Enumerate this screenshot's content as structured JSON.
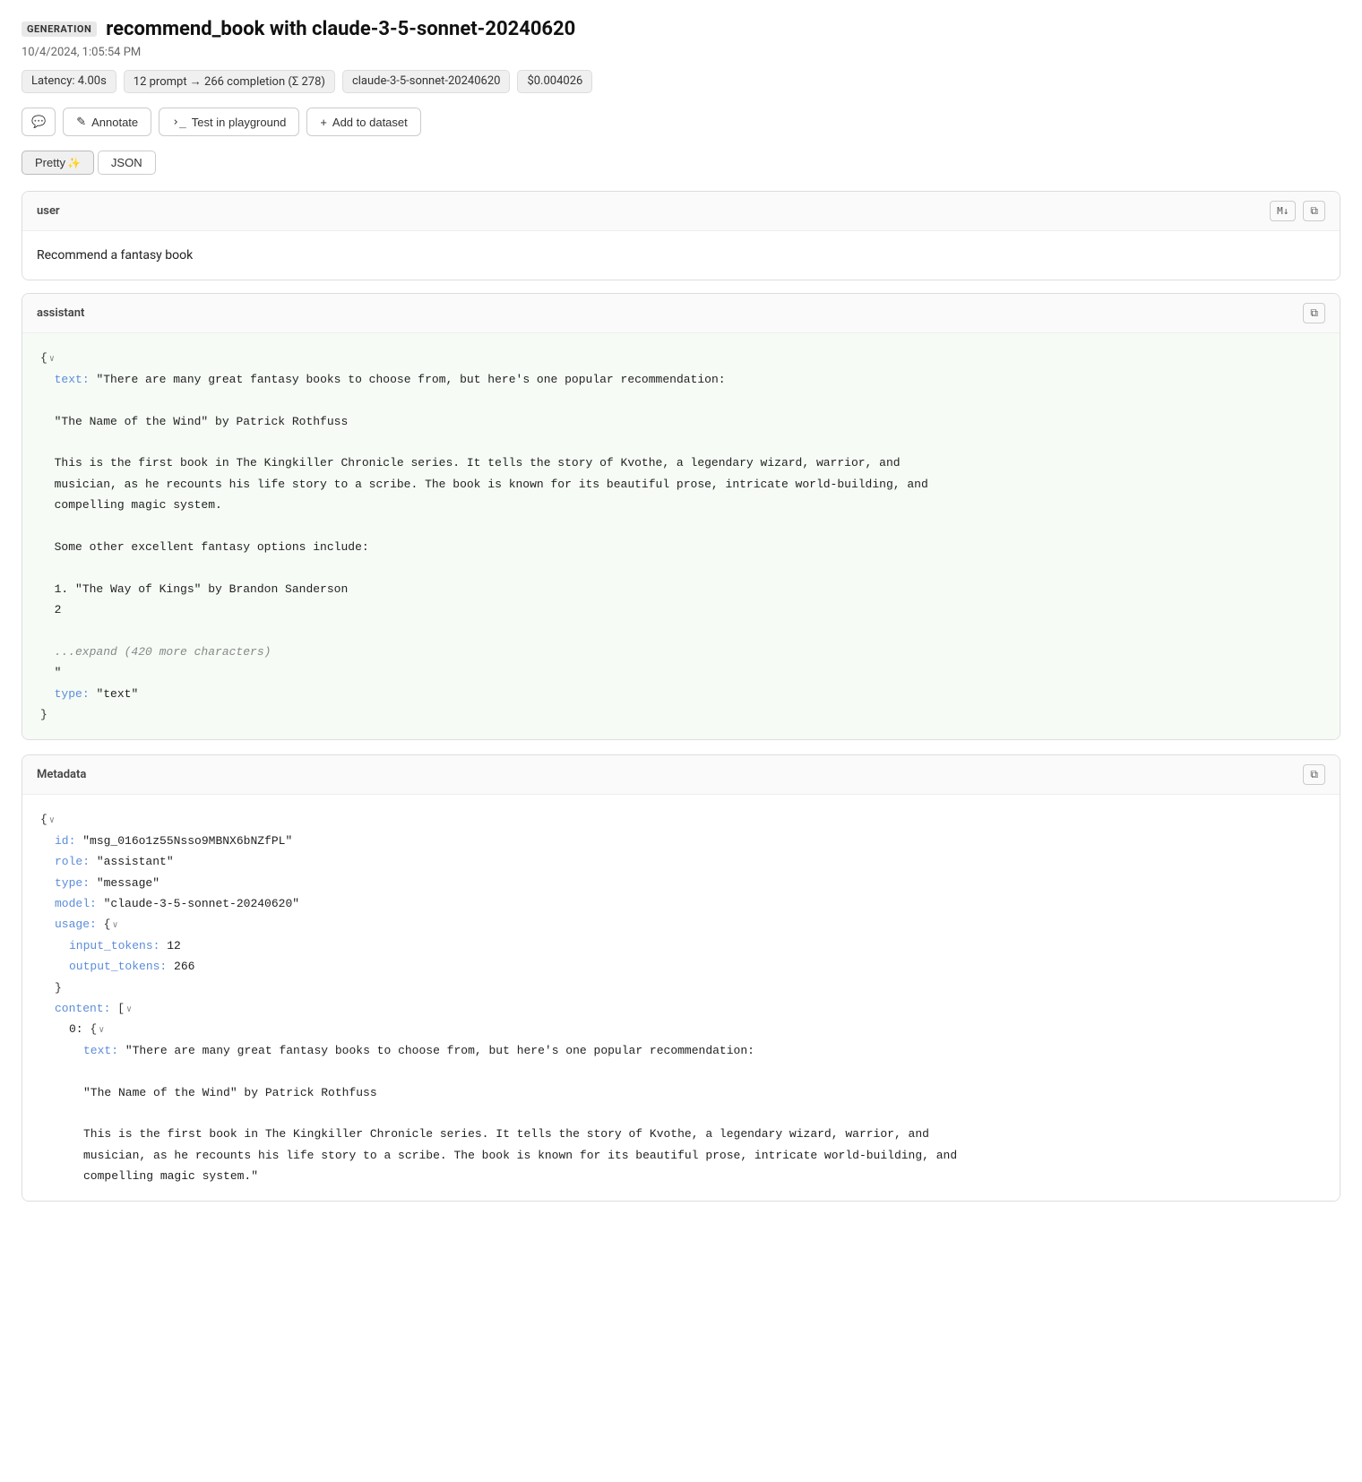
{
  "header": {
    "badge": "GENERATION",
    "title": "recommend_book with claude-3-5-sonnet-20240620",
    "timestamp": "10/4/2024, 1:05:54 PM"
  },
  "meta": {
    "latency": "Latency: 4.00s",
    "tokens": "12 prompt → 266 completion (Σ 278)",
    "model": "claude-3-5-sonnet-20240620",
    "cost": "$0.004026"
  },
  "actions": {
    "comment": "comment-icon",
    "annotate": "Annotate",
    "test": "Test in playground",
    "add_dataset": "Add to dataset"
  },
  "view_toggle": {
    "pretty": "Pretty",
    "sparkle": "✨",
    "json": "JSON"
  },
  "messages": [
    {
      "role": "user",
      "content": "Recommend a fantasy book"
    }
  ],
  "assistant": {
    "role": "assistant",
    "json_lines": [
      "{↓",
      "  text: \"There are many great fantasy books to choose from, but here's one popular recommendation:",
      "",
      "  \\\"The Name of the Wind\\\" by Patrick Rothfuss",
      "",
      "  This is the first book in The Kingkiller Chronicle series. It tells the story of Kvothe, a legendary wizard, warrior, and",
      "  musician, as he recounts his life story to a scribe. The book is known for its beautiful prose, intricate world-building, and",
      "  compelling magic system.",
      "",
      "  Some other excellent fantasy options include:",
      "",
      "  1. \\\"The Way of Kings\\\" by Brandon Sanderson",
      "  2",
      "",
      "  ...expand (420 more characters)",
      "  \"",
      "  type: \"text\"",
      "}"
    ]
  },
  "metadata": {
    "title": "Metadata",
    "json_lines": [
      "{↓",
      "  id: \"msg_016o1z55Nsso9MBNX6bNZfPL\"",
      "  role: \"assistant\"",
      "  type: \"message\"",
      "  model: \"claude-3-5-sonnet-20240620\"",
      "  usage: {↓",
      "    input_tokens: 12",
      "    output_tokens: 266",
      "  }",
      "  content: [↓",
      "    0: {↓",
      "      text: \"There are many great fantasy books to choose from, but here's one popular recommendation:",
      "",
      "      \\\"The Name of the Wind\\\" by Patrick Rothfuss",
      "",
      "      This is the first book in The Kingkiller Chronicle series. It tells the story of Kvothe, a legendary wizard, warrior, and",
      "      musician, as he recounts his life story to a scribe. The book is known for its beautiful prose, intricate world-building, and",
      "      compelling magic system.\""
    ]
  },
  "icons": {
    "copy": "⧉",
    "markdown": "M↓",
    "comment_unicode": "💬",
    "annotate_unicode": "✎",
    "playground_unicode": ">_",
    "plus_unicode": "+"
  }
}
